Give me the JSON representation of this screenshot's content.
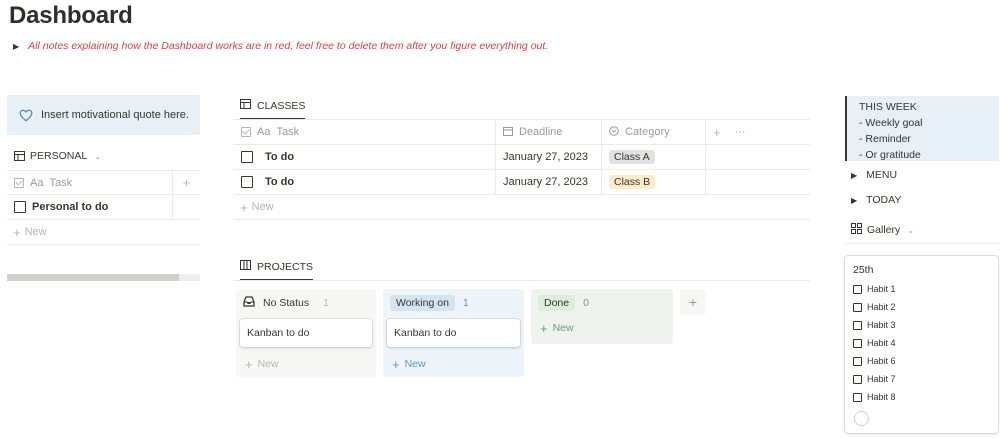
{
  "page": {
    "title": "Dashboard",
    "note": "All notes explaining how the Dashboard works are in red, feel free to delete them after you figure everything out."
  },
  "callout": {
    "text": "Insert motivational quote here.",
    "icon": "heart-icon"
  },
  "personal": {
    "title": "PERSONAL",
    "header_task": "Task",
    "header_task_prefix": "Aa",
    "rows": [
      {
        "task": "Personal to do"
      }
    ],
    "new_label": "New"
  },
  "classes": {
    "title": "CLASSES",
    "headers": {
      "task": "Task",
      "task_prefix": "Aa",
      "deadline": "Deadline",
      "category": "Category",
      "more": "···"
    },
    "rows": [
      {
        "task": "To do",
        "deadline": "January 27, 2023",
        "category": "Class A",
        "tag_color": "#e3e2e0"
      },
      {
        "task": "To do",
        "deadline": "January 27, 2023",
        "category": "Class B",
        "tag_color": "#fdecc8"
      }
    ],
    "new_label": "New"
  },
  "projects": {
    "title": "PROJECTS",
    "columns": [
      {
        "label": "No Status",
        "count": "1",
        "card": "Kanban to do",
        "new_label": "New",
        "bg": "#f7f7f5",
        "label_bg": "transparent",
        "count_color": "#b7b6b3",
        "new_color": "#b7b6b3"
      },
      {
        "label": "Working on",
        "count": "1",
        "card": "Kanban to do",
        "new_label": "New",
        "bg": "#eef5fa",
        "label_bg": "#d3e5ef",
        "count_color": "#5b97bd",
        "new_color": "#5b97bd"
      },
      {
        "label": "Done",
        "count": "0",
        "new_label": "New",
        "bg": "#eef3ed",
        "label_bg": "#dbeddb",
        "count_color": "#6c9b7d",
        "new_color": "#6c9b7d"
      }
    ]
  },
  "week": {
    "title": "THIS WEEK",
    "items": [
      "- Weekly goal",
      "- Reminder",
      "- Or gratitude"
    ]
  },
  "toggles": {
    "menu": "MENU",
    "today": "TODAY"
  },
  "gallery": {
    "title": "Gallery",
    "card": {
      "title": "25th",
      "habits": [
        "Habit 1",
        "Habit 2",
        "Habit 3",
        "Habit 4",
        "Habit 6",
        "Habit 7",
        "Habit 8"
      ]
    }
  }
}
